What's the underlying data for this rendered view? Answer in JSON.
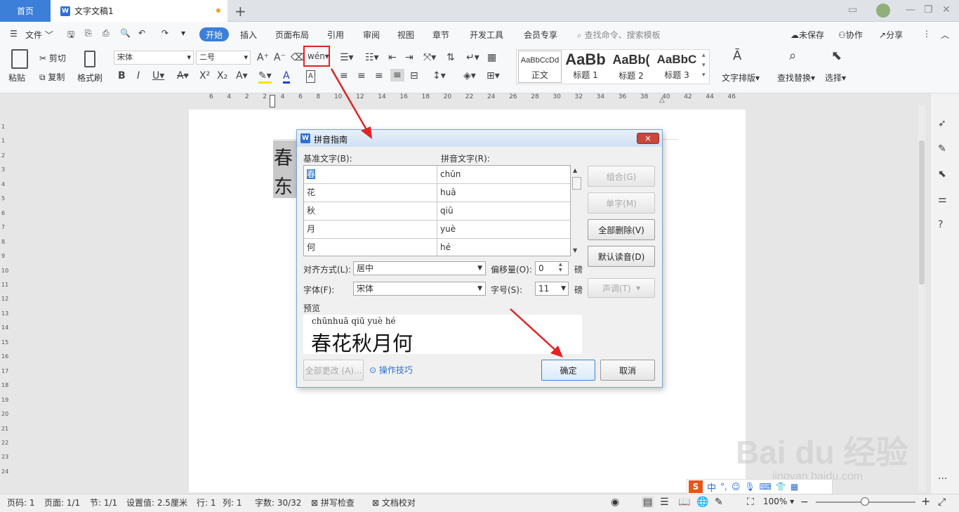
{
  "tabs": {
    "home": "首页",
    "document": "文字文稿1"
  },
  "menu": {
    "file": "文件",
    "items": [
      "开始",
      "插入",
      "页面布局",
      "引用",
      "审阅",
      "视图",
      "章节",
      "开发工具",
      "会员专享"
    ],
    "search_placeholder": "查找命令、搜索模板",
    "unsaved": "未保存",
    "collab": "协作",
    "share": "分享"
  },
  "ribbon": {
    "paste": "粘贴",
    "cut": "剪切",
    "copy": "复制",
    "format_painter": "格式刷",
    "font_name": "宋体",
    "font_size": "二号",
    "styles": [
      {
        "sample": "AaBbCcDd",
        "label": "正文"
      },
      {
        "sample": "AaBb",
        "label": "标题 1"
      },
      {
        "sample": "AaBb(",
        "label": "标题 2"
      },
      {
        "sample": "AaBbC",
        "label": "标题 3"
      }
    ],
    "text_layout": "文字排版",
    "find_replace": "查找替换",
    "select": "选择"
  },
  "ruler_numbers": [
    "6",
    "4",
    "2",
    "2",
    "4",
    "6",
    "8",
    "10",
    "12",
    "14",
    "16",
    "18",
    "20",
    "22",
    "24",
    "26",
    "28",
    "30",
    "32",
    "34",
    "36",
    "38",
    "40",
    "42",
    "44",
    "46"
  ],
  "vruler_numbers": [
    "1",
    "1",
    "2",
    "3",
    "4",
    "5",
    "6",
    "7",
    "8",
    "9",
    "10",
    "11",
    "12",
    "13",
    "14",
    "15",
    "16",
    "17",
    "18",
    "19",
    "20",
    "21",
    "22",
    "23",
    "24"
  ],
  "document_text": [
    "春",
    "东"
  ],
  "dialog": {
    "title": "拼音指南",
    "base_label": "基准文字(B):",
    "pinyin_label": "拼音文字(R):",
    "rows": [
      {
        "base": "春",
        "pinyin": "chūn"
      },
      {
        "base": "花",
        "pinyin": "huā"
      },
      {
        "base": "秋",
        "pinyin": "qiū"
      },
      {
        "base": "月",
        "pinyin": "yuè"
      },
      {
        "base": "何",
        "pinyin": "hé"
      }
    ],
    "buttons": {
      "group": "组合(G)",
      "single": "单字(M)",
      "clear_all": "全部删除(V)",
      "default_reading": "默认读音(D)",
      "tone": "声调(T)",
      "change_all": "全部更改 (A)...",
      "ok": "确定",
      "cancel": "取消"
    },
    "align_label": "对齐方式(L):",
    "align_value": "居中",
    "offset_label": "偏移量(O):",
    "offset_value": "0",
    "offset_unit": "磅",
    "font_label": "字体(F):",
    "font_value": "宋体",
    "size_label": "字号(S):",
    "size_value": "11",
    "size_unit": "磅",
    "preview_label": "预览",
    "preview_pinyin": "chūnhuā qiū yuè hé",
    "preview_text": "春花秋月何",
    "tips_link": "操作技巧"
  },
  "status": {
    "page": "页码: 1",
    "pages": "页面: 1/1",
    "section": "节: 1/1",
    "setting": "设置值: 2.5厘米",
    "row": "行: 1",
    "col": "列: 1",
    "words": "字数: 30/32",
    "spell": "拼写检查",
    "proof": "文档校对",
    "zoom": "100%"
  },
  "watermark": {
    "brand": "Bai du 经验",
    "url": "jingyan.baidu.com"
  },
  "ime": {
    "lang": "中"
  },
  "colors": {
    "accent": "#3b7fd8",
    "annotation": "#e02424"
  }
}
